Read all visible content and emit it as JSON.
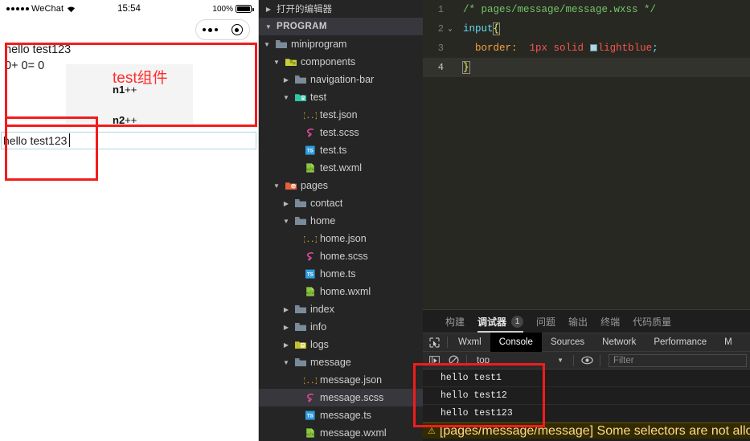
{
  "simulator": {
    "statusbar": {
      "carrier": "WeChat",
      "time": "15:54",
      "battery": "100%"
    },
    "capsule": {
      "more_icon": "more-dots-icon",
      "target_icon": "target-circle-icon"
    },
    "page": {
      "line1": "hello test123",
      "line2": "0+ 0= 0",
      "component_title": "test组件",
      "button_n1": "n1",
      "button_n1_suffix": "++",
      "button_n2": "n2",
      "button_n2_suffix": "++",
      "input_value": "hello test123",
      "input_placeholder": ""
    }
  },
  "explorer": {
    "open_editors_label": "打开的编辑器",
    "program_label": "PROGRAM",
    "tree": [
      {
        "label": "miniprogram",
        "icon": "folder-icon",
        "indent": 1,
        "arrow": "down",
        "selected": false
      },
      {
        "label": "components",
        "icon": "folder-components-icon",
        "indent": 2,
        "arrow": "down",
        "selected": false
      },
      {
        "label": "navigation-bar",
        "icon": "folder-icon",
        "indent": 3,
        "arrow": "right",
        "selected": false
      },
      {
        "label": "test",
        "icon": "folder-test-icon",
        "indent": 3,
        "arrow": "down",
        "selected": false
      },
      {
        "label": "test.json",
        "icon": "json-icon",
        "indent": 4,
        "arrow": "none",
        "selected": false
      },
      {
        "label": "test.scss",
        "icon": "scss-icon",
        "indent": 4,
        "arrow": "none",
        "selected": false
      },
      {
        "label": "test.ts",
        "icon": "ts-icon",
        "indent": 4,
        "arrow": "none",
        "selected": false
      },
      {
        "label": "test.wxml",
        "icon": "wxml-icon",
        "indent": 4,
        "arrow": "none",
        "selected": false
      },
      {
        "label": "pages",
        "icon": "folder-pages-icon",
        "indent": 2,
        "arrow": "down",
        "selected": false
      },
      {
        "label": "contact",
        "icon": "folder-icon",
        "indent": 3,
        "arrow": "right",
        "selected": false
      },
      {
        "label": "home",
        "icon": "folder-icon",
        "indent": 3,
        "arrow": "down",
        "selected": false
      },
      {
        "label": "home.json",
        "icon": "json-icon",
        "indent": 4,
        "arrow": "none",
        "selected": false
      },
      {
        "label": "home.scss",
        "icon": "scss-icon",
        "indent": 4,
        "arrow": "none",
        "selected": false
      },
      {
        "label": "home.ts",
        "icon": "ts-icon",
        "indent": 4,
        "arrow": "none",
        "selected": false
      },
      {
        "label": "home.wxml",
        "icon": "wxml-icon",
        "indent": 4,
        "arrow": "none",
        "selected": false
      },
      {
        "label": "index",
        "icon": "folder-icon",
        "indent": 3,
        "arrow": "right",
        "selected": false
      },
      {
        "label": "info",
        "icon": "folder-icon",
        "indent": 3,
        "arrow": "right",
        "selected": false
      },
      {
        "label": "logs",
        "icon": "folder-logs-icon",
        "indent": 3,
        "arrow": "right",
        "selected": false
      },
      {
        "label": "message",
        "icon": "folder-icon",
        "indent": 3,
        "arrow": "down",
        "selected": false
      },
      {
        "label": "message.json",
        "icon": "json-icon",
        "indent": 4,
        "arrow": "none",
        "selected": false
      },
      {
        "label": "message.scss",
        "icon": "scss-icon",
        "indent": 4,
        "arrow": "none",
        "selected": true
      },
      {
        "label": "message.ts",
        "icon": "ts-icon",
        "indent": 4,
        "arrow": "none",
        "selected": false
      },
      {
        "label": "message.wxml",
        "icon": "wxml-icon",
        "indent": 4,
        "arrow": "none",
        "selected": false
      }
    ]
  },
  "editor": {
    "lines": [
      {
        "num": "1",
        "fold": "",
        "active": false
      },
      {
        "num": "2",
        "fold": "⌄",
        "active": false
      },
      {
        "num": "3",
        "fold": "",
        "active": false
      },
      {
        "num": "4",
        "fold": "",
        "active": true
      }
    ],
    "code": {
      "comment": "/* pages/message/message.wxss */",
      "selector": "input",
      "open_brace": "{",
      "property": "border:",
      "value_size": "1px solid",
      "value_color": "lightblue",
      "semicolon": ";",
      "close_brace": "}",
      "swatch_color": "#add8e6"
    }
  },
  "panel": {
    "tabs": [
      {
        "label": "构建",
        "badge": "",
        "active": false
      },
      {
        "label": "调试器",
        "badge": "1",
        "active": true
      },
      {
        "label": "问题",
        "badge": "",
        "active": false
      },
      {
        "label": "输出",
        "badge": "",
        "active": false
      },
      {
        "label": "终端",
        "badge": "",
        "active": false
      },
      {
        "label": "代码质量",
        "badge": "",
        "active": false
      }
    ],
    "devtools_tabs": [
      {
        "label": "Wxml",
        "active": false
      },
      {
        "label": "Console",
        "active": true
      },
      {
        "label": "Sources",
        "active": false
      },
      {
        "label": "Network",
        "active": false
      },
      {
        "label": "Performance",
        "active": false
      },
      {
        "label": "M",
        "active": false
      }
    ],
    "toolbar": {
      "inspect_icon": "inspect-cursor-icon",
      "execute_icon": "execute-arrow-icon",
      "clear_icon": "clear-console-icon",
      "context": "top",
      "eye_icon": "eye-icon",
      "filter_placeholder": "Filter"
    },
    "console_logs": [
      {
        "text": "hello test1"
      },
      {
        "text": "hello test12"
      },
      {
        "text": "hello test123"
      }
    ],
    "warning": {
      "icon": "warning-triangle-icon",
      "text": "[pages/message/message] Some selectors are not allowed in"
    }
  },
  "annotations": {
    "box1": "red-highlight-component-area",
    "box2": "red-highlight-input-area",
    "box3": "red-highlight-console-logs",
    "color": "#f41b1b"
  }
}
